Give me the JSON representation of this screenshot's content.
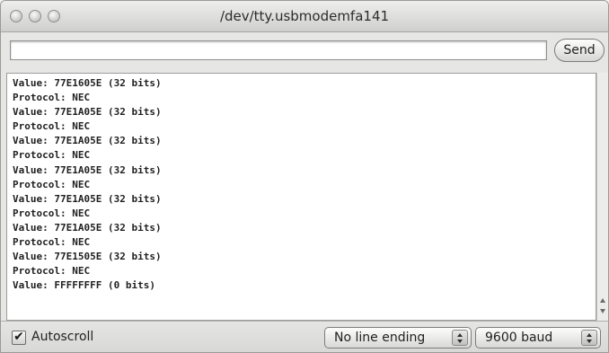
{
  "window": {
    "title": "/dev/tty.usbmodemfa141"
  },
  "send": {
    "input_value": "",
    "button_label": "Send"
  },
  "console": {
    "lines": [
      "Value: 77E1605E (32 bits)",
      "Protocol: NEC",
      "Value: 77E1A05E (32 bits)",
      "Protocol: NEC",
      "Value: 77E1A05E (32 bits)",
      "Protocol: NEC",
      "Value: 77E1A05E (32 bits)",
      "Protocol: NEC",
      "Value: 77E1A05E (32 bits)",
      "Protocol: NEC",
      "Value: 77E1A05E (32 bits)",
      "Protocol: NEC",
      "Value: 77E1505E (32 bits)",
      "Protocol: NEC",
      "Value: FFFFFFFF (0 bits)"
    ]
  },
  "footer": {
    "autoscroll_label": "Autoscroll",
    "autoscroll_checked": true,
    "line_ending": "No line ending",
    "baud_rate": "9600 baud"
  }
}
